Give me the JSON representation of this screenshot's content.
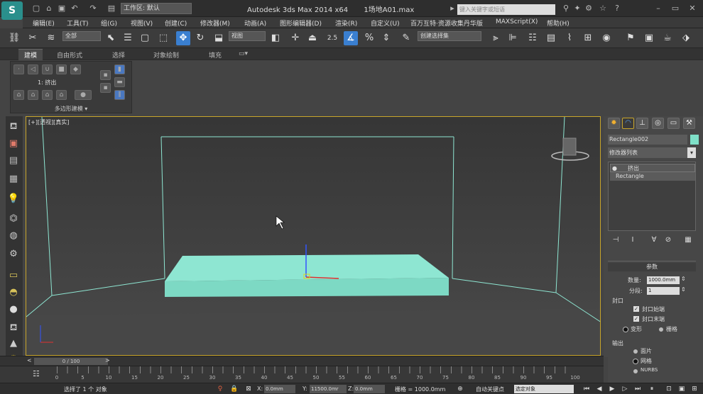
{
  "title_bar": {
    "logo_label": "S",
    "workspace_label": "工作区: 默认",
    "app_title": "Autodesk 3ds Max  2014 x64",
    "file_name": "1场地A01.max",
    "search_placeholder": "键入关键字或短语"
  },
  "menu": [
    "编辑(E)",
    "工具(T)",
    "组(G)",
    "视图(V)",
    "创建(C)",
    "修改器(M)",
    "动画(A)",
    "图形编辑器(D)",
    "渲染(R)",
    "自定义(U)",
    "百万互特·资源收集丹华版",
    "MAXScript(X)",
    "帮助(H)"
  ],
  "toolbar": {
    "filter_dropdown": "全部",
    "refcoord_dropdown": "视图",
    "selection_set": "创建选择集",
    "snap_label": "2.5"
  },
  "ribbon": {
    "tabs": [
      "建模",
      "自由形式",
      "选择",
      "对象绘制",
      "填充"
    ],
    "subobject_label": "1: 挤出",
    "footer_label": "多边形建模 ▾"
  },
  "viewport": {
    "label": "[+][透视][真实]"
  },
  "command_panel": {
    "object_name": "Rectangle002",
    "object_color": "#7fe0c8",
    "modifier_list_label": "修改器列表",
    "stack": [
      "挤出",
      "Rectangle"
    ],
    "params_title": "参数",
    "amount_label": "数量:",
    "amount_value": "1000.0mm",
    "segments_label": "分段:",
    "segments_value": "1",
    "capping_label": "封口",
    "cap_start_label": "封口始端",
    "cap_end_label": "封口末端",
    "morph_label": "变形",
    "grid_label": "栅格",
    "output_label": "输出",
    "patch_label": "面片",
    "mesh_label": "网格",
    "nurbs_label": "NURBS"
  },
  "timeline": {
    "frame_slider": "0 / 100",
    "ticks": [
      "0",
      "5",
      "10",
      "15",
      "20",
      "25",
      "30",
      "35",
      "40",
      "45",
      "50",
      "55",
      "60",
      "65",
      "70",
      "75",
      "80",
      "85",
      "90",
      "95",
      "100"
    ]
  },
  "status_bar": {
    "selection_text": "选择了 1 个 对象",
    "x_label": "X:",
    "x_value": "0.0mm",
    "y_label": "Y:",
    "y_value": "11500.0mr",
    "z_label": "Z:",
    "z_value": "0.0mm",
    "grid_text": "栅格 = 1000.0mm",
    "autokey_label": "自动关键点",
    "selected_dropdown": "选定对象"
  },
  "colors": {
    "accent_blue": "#3a7fd0",
    "viewport_border": "#c8a52a",
    "object_fill": "#7fe0c8",
    "wire_cyan": "#8ee6d2"
  }
}
